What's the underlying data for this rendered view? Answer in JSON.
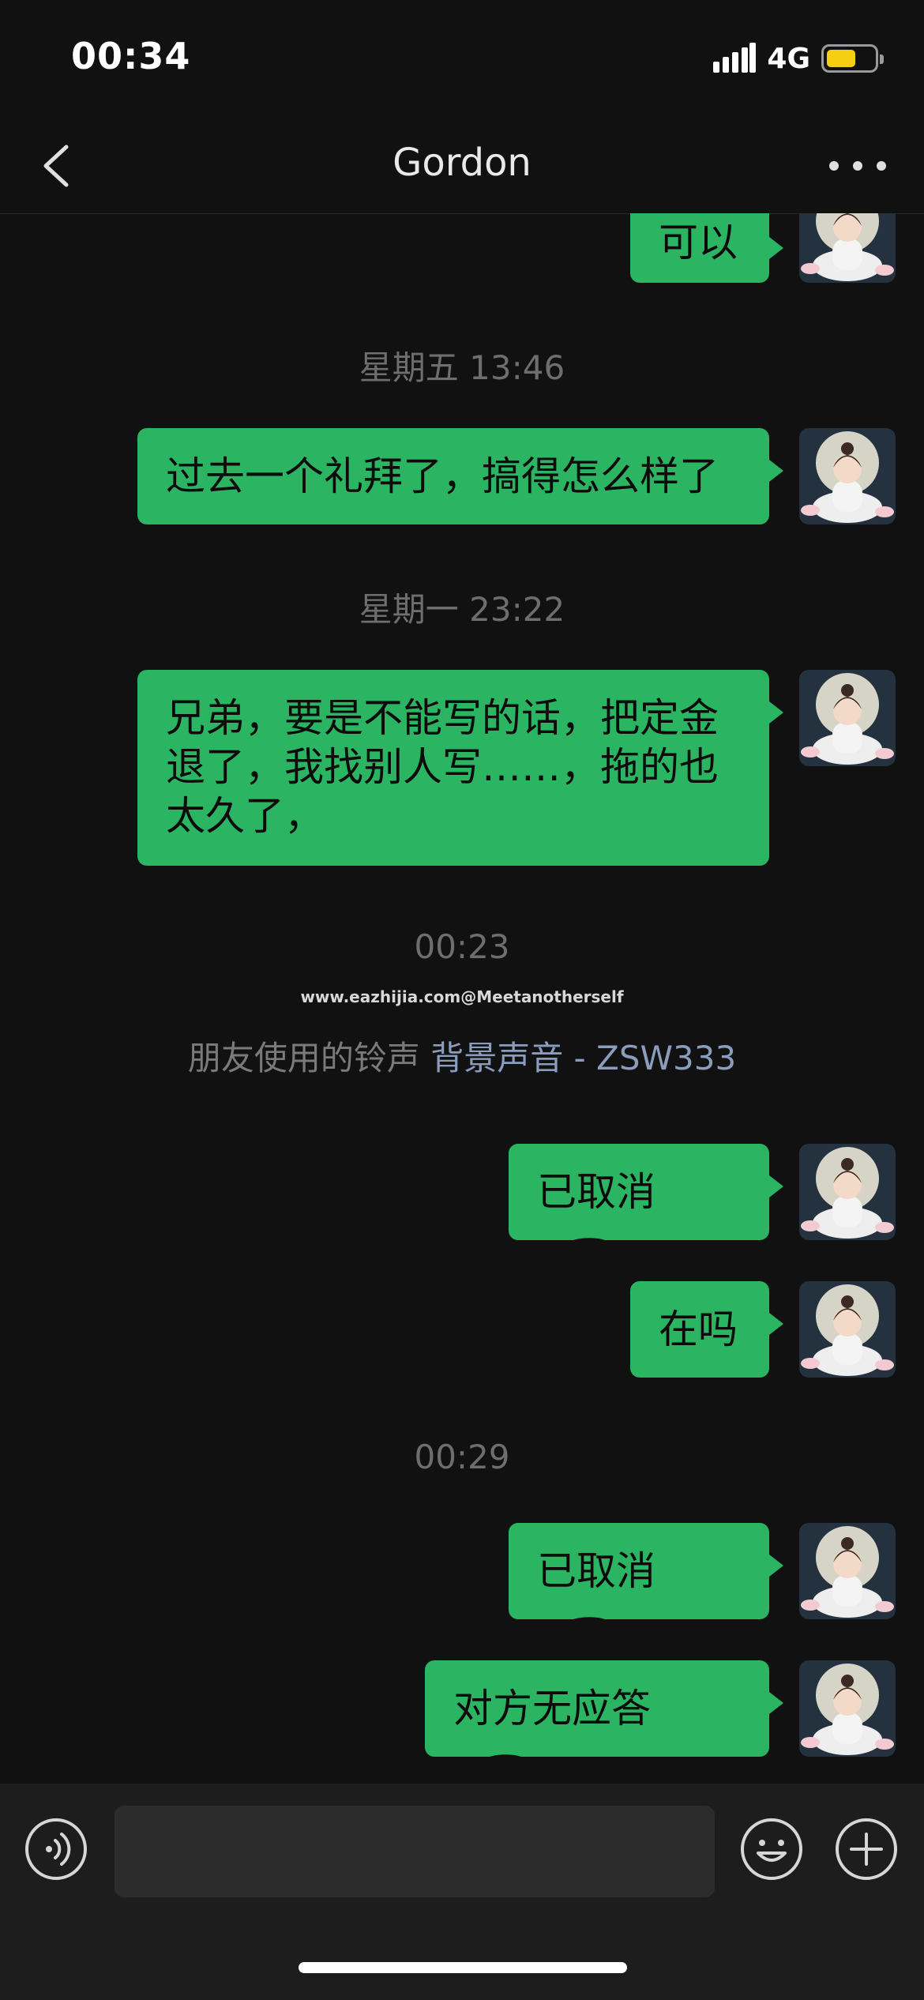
{
  "status": {
    "time": "00:34",
    "network": "4G",
    "battery_level": 0.62
  },
  "header": {
    "title": "Gordon"
  },
  "messages": [
    {
      "text": "可以"
    },
    {
      "timestamp": "星期五 13:46"
    },
    {
      "text": "过去一个礼拜了，搞得怎么样了"
    },
    {
      "timestamp": "星期一 23:22"
    },
    {
      "text": "兄弟，要是不能写的话，把定金退了，我找别人写……，拖的也太久了，"
    },
    {
      "timestamp": "00:23"
    },
    {
      "watermark": "www.eazhijia.com@Meetanotherself"
    },
    {
      "ringtone_prefix": "朋友使用的铃声",
      "ringtone_name": "背景声音 - ZSW333"
    },
    {
      "text": "已取消",
      "type": "call"
    },
    {
      "text": "在吗"
    },
    {
      "timestamp": "00:29"
    },
    {
      "text": "已取消",
      "type": "call"
    },
    {
      "text": "对方无应答",
      "type": "call"
    }
  ],
  "input": {
    "value": "",
    "placeholder": ""
  },
  "colors": {
    "bubble": "#2bb462",
    "background": "#111111",
    "accent_link": "#8a9dbc"
  },
  "icons": {
    "back": "chevron-left-icon",
    "more": "more-dots-icon",
    "voice": "voice-icon",
    "emoji": "emoji-icon",
    "plus": "plus-icon",
    "call": "phone-hangup-icon"
  }
}
